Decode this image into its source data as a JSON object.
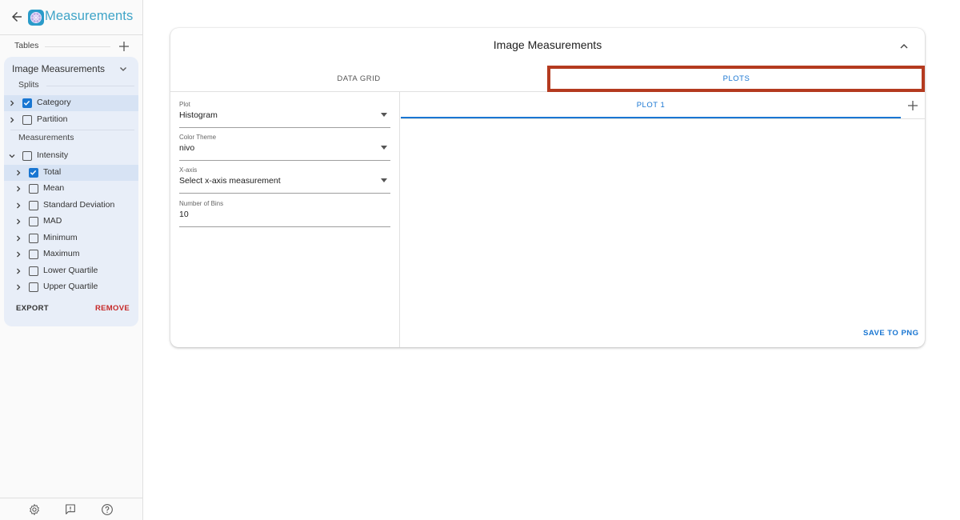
{
  "app": {
    "title": "Measurements",
    "icons": {
      "back": "arrow-left-icon",
      "logo": "app-logo-icon"
    }
  },
  "sidebar": {
    "tables_label": "Tables",
    "table": {
      "name": "Image Measurements",
      "splits_label": "Splits",
      "splits": [
        {
          "label": "Category",
          "checked": true,
          "selected": true
        },
        {
          "label": "Partition",
          "checked": false,
          "selected": false
        }
      ],
      "measurements_label": "Measurements",
      "measurements": [
        {
          "label": "Intensity",
          "checked": false,
          "selected": false,
          "expanded": true,
          "level": 0
        },
        {
          "label": "Total",
          "checked": true,
          "selected": true,
          "expanded": false,
          "level": 1
        },
        {
          "label": "Mean",
          "checked": false,
          "selected": false,
          "expanded": false,
          "level": 1
        },
        {
          "label": "Standard Deviation",
          "checked": false,
          "selected": false,
          "expanded": false,
          "level": 1
        },
        {
          "label": "MAD",
          "checked": false,
          "selected": false,
          "expanded": false,
          "level": 1
        },
        {
          "label": "Minimum",
          "checked": false,
          "selected": false,
          "expanded": false,
          "level": 1
        },
        {
          "label": "Maximum",
          "checked": false,
          "selected": false,
          "expanded": false,
          "level": 1
        },
        {
          "label": "Lower Quartile",
          "checked": false,
          "selected": false,
          "expanded": false,
          "level": 1
        },
        {
          "label": "Upper Quartile",
          "checked": false,
          "selected": false,
          "expanded": false,
          "level": 1
        }
      ],
      "export_label": "EXPORT",
      "remove_label": "REMOVE"
    },
    "footer_icons": [
      "settings-icon",
      "feedback-icon",
      "help-icon"
    ]
  },
  "panel": {
    "title": "Image Measurements",
    "tabs": [
      {
        "label": "DATA GRID",
        "active": false
      },
      {
        "label": "PLOTS",
        "active": true
      }
    ],
    "settings": {
      "plot": {
        "label": "Plot",
        "value": "Histogram"
      },
      "color_theme": {
        "label": "Color Theme",
        "value": "nivo"
      },
      "x_axis": {
        "label": "X-axis",
        "value": "Select x-axis measurement"
      },
      "bins": {
        "label": "Number of Bins",
        "value": "10"
      }
    },
    "plot_tabs": [
      {
        "label": "PLOT 1",
        "active": true
      }
    ],
    "save_label": "SAVE TO PNG"
  },
  "colors": {
    "accent": "#1976d2",
    "title": "#3fa4c8",
    "remove": "#c62828",
    "highlight": "#b43a1f",
    "card": "#e8eef8"
  }
}
